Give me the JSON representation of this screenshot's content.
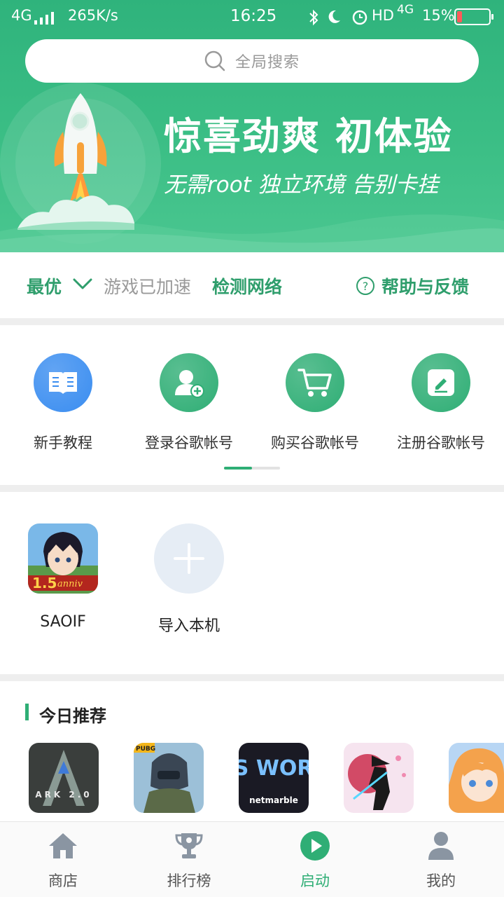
{
  "status_bar": {
    "network": "4G",
    "speed": "265K/s",
    "time": "16:25",
    "hd": "HD",
    "network2": "4G",
    "battery": "15%",
    "battery_level": 0.15
  },
  "search": {
    "placeholder": "全局搜索"
  },
  "hero": {
    "title": "惊喜劲爽  初体验",
    "subtitle": "无需root  独立环境  告别卡挂"
  },
  "accelerator": {
    "mode": "最优",
    "status": "游戏已加速",
    "detect": "检测网络",
    "help": "帮助与反馈",
    "help_glyph": "?"
  },
  "quick_actions": [
    {
      "label": "新手教程",
      "icon": "book-icon",
      "color": "#3a8df0"
    },
    {
      "label": "登录谷歌帐号",
      "icon": "user-add-icon",
      "color": "#2fae75"
    },
    {
      "label": "购买谷歌帐号",
      "icon": "cart-icon",
      "color": "#2fae75"
    },
    {
      "label": "注册谷歌帐号",
      "icon": "edit-icon",
      "color": "#2fae75"
    }
  ],
  "pager": {
    "pages": 2,
    "current": 1
  },
  "my_games": {
    "items": [
      {
        "name": "SAOIF"
      }
    ],
    "add_label": "导入本机"
  },
  "recommend": {
    "title": "今日推荐",
    "games": [
      {
        "icon": "ark-game-icon",
        "text": "ARK 2.0"
      },
      {
        "icon": "pubg-game-icon",
        "text": "PUBG"
      },
      {
        "icon": "bts-world-game-icon",
        "text": "BTS WORLD",
        "subtext": "netmarble"
      },
      {
        "icon": "shadow-fight-game-icon",
        "text": ""
      },
      {
        "icon": "anime-girl-game-icon",
        "text": ""
      }
    ]
  },
  "tabs": [
    {
      "label": "商店",
      "icon": "home-icon"
    },
    {
      "label": "排行榜",
      "icon": "trophy-icon"
    },
    {
      "label": "启动",
      "icon": "play-icon",
      "active": true
    },
    {
      "label": "我的",
      "icon": "profile-icon"
    }
  ],
  "colors": {
    "brand_green": "#2fae75",
    "text_green": "#2f9e6c",
    "grey_text": "#9a9a9a"
  }
}
